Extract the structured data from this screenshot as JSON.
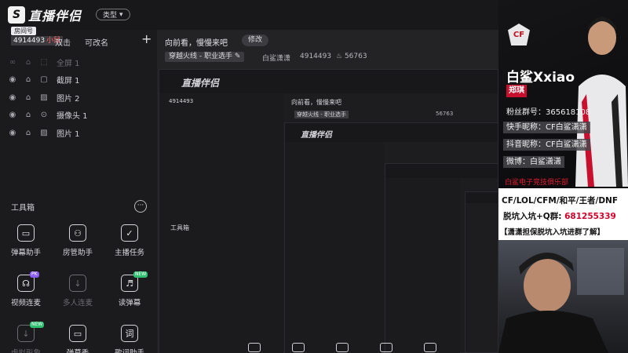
{
  "app": {
    "logo_text": "直播伴侣",
    "type_pill": "类型",
    "room_badge": "房间号",
    "room_id": "4914493",
    "room_level": "小鼠",
    "tabs": [
      "双击",
      "可改名"
    ],
    "add_label": "+"
  },
  "layers": [
    {
      "label": "全屏 1",
      "icon": "fullscreen-icon",
      "dim": true
    },
    {
      "label": "截屏 1",
      "icon": "capture-icon",
      "dim": false
    },
    {
      "label": "图片 2",
      "icon": "image-icon",
      "dim": false
    },
    {
      "label": "摄像头 1",
      "icon": "camera-icon",
      "dim": false
    },
    {
      "label": "图片 1",
      "icon": "image-icon",
      "dim": false
    }
  ],
  "tools": {
    "header": "工具箱",
    "more": "···",
    "items": [
      {
        "label": "弹幕助手",
        "glyph": "▭",
        "badge": "",
        "dim": false
      },
      {
        "label": "房管助手",
        "glyph": "⚇",
        "badge": "",
        "dim": false
      },
      {
        "label": "主播任务",
        "glyph": "✓",
        "badge": "",
        "dim": false
      },
      {
        "label": "视频连麦",
        "glyph": "☊",
        "badge": "PK",
        "dim": false
      },
      {
        "label": "多人连麦",
        "glyph": "↓",
        "badge": "",
        "dim": true
      },
      {
        "label": "读弹幕",
        "glyph": "♬",
        "badge": "NEW",
        "dim": false
      },
      {
        "label": "虚拟形象",
        "glyph": "↓",
        "badge": "NEW",
        "dim": true
      },
      {
        "label": "弹幕秀",
        "glyph": "▭",
        "badge": "",
        "dim": false
      },
      {
        "label": "歌词助手",
        "glyph": "词",
        "badge": "",
        "dim": false
      }
    ]
  },
  "preview": {
    "slogan": "向前看，慢慢来吧",
    "modify_label": "修改",
    "category": "穿越火线 - 职业选手",
    "streamer": "白鲨潇潇",
    "room_id": "4914493",
    "heat": "56763"
  },
  "overlay": {
    "team_logo": "CF",
    "name": "白鲨Xxiao",
    "real_name": "郑琪",
    "fans": "粉丝群号：365618108",
    "kuaishou": "快手昵称：CF白鲨潇潇",
    "douyin": "抖音昵称：CF白鲨潇潇",
    "weibo": "微博：白鲨潇潇",
    "club": "白鲨电子竞技俱乐部",
    "promo1": "CF/LOL/CFM/和平/王者/DNF",
    "promo2_prefix": "脱坑入坑+Q群:",
    "promo2_qq": "681255339",
    "promo3": "【潇潇担保脱坑入坑进群了解】"
  },
  "colors": {
    "background": "#1b1b1e",
    "accent_red": "#c8102e",
    "new_badge": "#2fbf71",
    "pk_badge": "#8a5cf6"
  }
}
